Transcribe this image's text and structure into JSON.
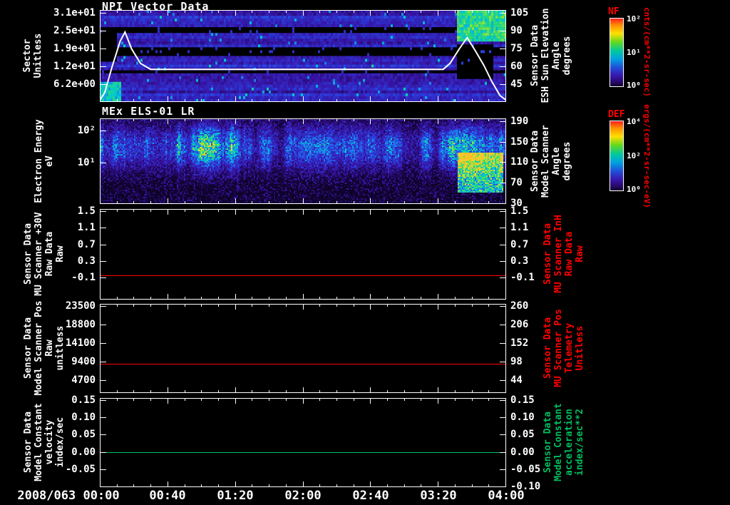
{
  "page": {
    "background": "#000000",
    "x_axis": {
      "labels": [
        "2008/063 00:00",
        "00:40",
        "01:20",
        "02:00",
        "02:40",
        "03:20",
        "04:00"
      ]
    }
  },
  "colors": {
    "axis_text": "#ffffff",
    "red_series": "#ff0000",
    "green_series": "#00bf5f",
    "colorbar_label": "#ff0000"
  },
  "colorbars": [
    {
      "label": "NF",
      "label_color": "#ff0000",
      "ticks": [
        "10²",
        "10¹",
        "10⁰"
      ],
      "units": "cnts/(cm**2-sr-sec)"
    },
    {
      "label": "DEF",
      "label_color": "#ff0000",
      "ticks": [
        "10⁴",
        "10²",
        "10⁰"
      ],
      "units": "ergs/(cm**2-sr-sec-eV)"
    }
  ],
  "chart_data": [
    {
      "type": "heatmap",
      "title": "NPI Vector Data",
      "x_ticks": [
        "00:00",
        "00:40",
        "01:20",
        "02:00",
        "02:40",
        "03:20",
        "04:00"
      ],
      "x_start": "2008/063 00:00",
      "x_end": "04:00",
      "left_axis": {
        "label": "Sector\nUnitless",
        "ticks": [
          "3.1e+01",
          "2.5e+01",
          "1.9e+01",
          "1.2e+01",
          "6.2e+00"
        ],
        "tick_values": [
          31,
          24.8,
          18.6,
          12.4,
          6.2
        ],
        "ylim": [
          0,
          32
        ],
        "scale": "linear"
      },
      "right_axis": {
        "label": "Sensor Data\nESH Sun Elevation\nAngle\ndegrees",
        "ticks": [
          "105",
          "90",
          "75",
          "60",
          "45"
        ],
        "tick_values": [
          105,
          90,
          75,
          60,
          45
        ],
        "ylim": [
          30,
          107.4
        ],
        "scale": "linear",
        "color": "#ffffff"
      },
      "colorbar_index": 0,
      "description": "32 azimuthal sectors vs time; mostly violet-blue low counts with black data-gap row bands, a bright cyan region after ~03:30, and a white sun-elevation trace with peaks near 00:15 and 03:35",
      "overlay": {
        "name": "sun-elevation-trace",
        "color": "#ffffff",
        "points": [
          [
            0,
            0.98
          ],
          [
            0.012,
            0.9
          ],
          [
            0.03,
            0.62
          ],
          [
            0.05,
            0.34
          ],
          [
            0.062,
            0.24
          ],
          [
            0.078,
            0.42
          ],
          [
            0.1,
            0.58
          ],
          [
            0.125,
            0.645
          ],
          [
            0.3,
            0.645
          ],
          [
            0.6,
            0.645
          ],
          [
            0.845,
            0.645
          ],
          [
            0.862,
            0.58
          ],
          [
            0.885,
            0.42
          ],
          [
            0.904,
            0.3
          ],
          [
            0.925,
            0.45
          ],
          [
            0.945,
            0.6
          ],
          [
            0.965,
            0.78
          ],
          [
            0.985,
            0.93
          ],
          [
            1,
            0.98
          ]
        ]
      },
      "render": {
        "rows": 32,
        "cols": 190,
        "seed": 7,
        "black_row_bands": [
          [
            0.18,
            0.25
          ],
          [
            0.4,
            0.5
          ],
          [
            0.63,
            0.68
          ]
        ],
        "left_black": {
          "x1": 0.04,
          "rows": [
            0.25,
            0.55
          ]
        },
        "left_bright": {
          "x1": 0.05,
          "rows": [
            0.78,
            1.0
          ],
          "level": 0.5
        },
        "right_bright": {
          "x0": 0.877,
          "rows": [
            0,
            0.33
          ],
          "level": 0.55
        },
        "right_black": {
          "x0": 0.877,
          "x1": 0.965,
          "rows": [
            0.35,
            0.72
          ]
        }
      }
    },
    {
      "type": "heatmap",
      "title": "MEx ELS-01 LR",
      "left_axis": {
        "label": "Electron Energy\neV",
        "ticks": [
          "10²",
          "10¹"
        ],
        "tick_values": [
          100,
          10
        ],
        "ylim": [
          0.5,
          240
        ],
        "scale": "log"
      },
      "right_axis": {
        "label": "Sensor Data\nModel Scanner\nAngle\ndegrees",
        "ticks": [
          "190",
          "150",
          "110",
          "70",
          "30"
        ],
        "tick_values": [
          190,
          150,
          110,
          70,
          30
        ],
        "ylim": [
          28,
          196
        ],
        "scale": "linear",
        "color": "#ffffff"
      },
      "colorbar_index": 1,
      "description": "Electron energy-time spectrogram; dark blue noise background with bright green/cyan vertical flux streaks concentrated before 01:20 and again after 03:00, strongest blob near 03:40",
      "render": {
        "rows": 60,
        "cols": 285,
        "seed": 13,
        "band_center": 0.33,
        "band_width": 0.17,
        "segments": [
          [
            0,
            0.36,
            0.9
          ],
          [
            0.36,
            0.66,
            0.5
          ],
          [
            0.66,
            0.85,
            0.55
          ],
          [
            0.85,
            1.0,
            0.75
          ]
        ],
        "blob": [
          0.88,
          0.99,
          0.4,
          0.85,
          0.9
        ]
      }
    },
    {
      "type": "line",
      "left_axis": {
        "label": "Sensor Data\nMU Scanner +30V\nRaw Data\nRaw",
        "ticks": [
          "1.5",
          "1.1",
          "0.7",
          "0.3",
          "-0.1"
        ],
        "tick_values": [
          1.5,
          1.1,
          0.7,
          0.3,
          -0.1
        ],
        "ylim": [
          -0.63,
          1.55
        ],
        "scale": "linear"
      },
      "right_axis": {
        "label": "Sensor Data\nMU Scanner InH\nRaw Data\nRaw",
        "ticks": [
          "1.5",
          "1.1",
          "0.7",
          "0.3",
          "-0.1"
        ],
        "tick_values": [
          1.5,
          1.1,
          0.7,
          0.3,
          -0.1
        ],
        "ylim": [
          -0.63,
          1.55
        ],
        "scale": "linear",
        "color": "#ff0000"
      },
      "series": [
        {
          "name": "MU Scanner raw",
          "color": "#ff0000",
          "value": -0.05,
          "axis": "left"
        }
      ]
    },
    {
      "type": "line",
      "left_axis": {
        "label": "Sensor Data\nModel Scanner Pos\nRaw\nunitless",
        "ticks": [
          "23500",
          "18800",
          "14100",
          "9400",
          "4700"
        ],
        "tick_values": [
          23500,
          18800,
          14100,
          9400,
          4700
        ],
        "ylim": [
          1400,
          24000
        ],
        "scale": "linear"
      },
      "right_axis": {
        "label": "Sensor Data\nMU Scanner Pos\nTelemetry\nUnitless",
        "ticks": [
          "260",
          "206",
          "152",
          "98",
          "44"
        ],
        "tick_values": [
          260,
          206,
          152,
          98,
          44
        ],
        "ylim": [
          6,
          266
        ],
        "scale": "linear",
        "color": "#ff0000"
      },
      "series": [
        {
          "name": "scanner position",
          "color": "#ff0000",
          "value": 8900,
          "axis": "left"
        }
      ]
    },
    {
      "type": "line",
      "left_axis": {
        "label": "Sensor Data\nModel Constant\nvelocity\nindex/sec",
        "ticks": [
          "0.15",
          "0.10",
          "0.05",
          "0.00",
          "-0.05"
        ],
        "tick_values": [
          0.15,
          0.1,
          0.05,
          0.0,
          -0.05
        ],
        "ylim": [
          -0.102,
          0.156
        ],
        "scale": "linear"
      },
      "right_axis": {
        "label": "Sensor Data\nModel Constant\nacceleration\nindex/sec**2",
        "ticks": [
          "0.15",
          "0.10",
          "0.05",
          "0.00",
          "-0.05",
          "-0.10"
        ],
        "tick_values": [
          0.15,
          0.1,
          0.05,
          0.0,
          -0.05,
          -0.1
        ],
        "ylim": [
          -0.102,
          0.156
        ],
        "scale": "linear",
        "color": "#00bf5f"
      },
      "series": [
        {
          "name": "model constant velocity",
          "color": "#00bf5f",
          "value": 0.0,
          "axis": "left"
        }
      ]
    }
  ]
}
